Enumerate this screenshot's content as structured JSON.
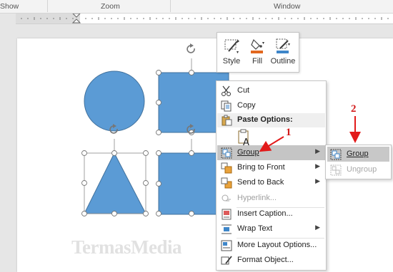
{
  "ribbon": {
    "groups": [
      {
        "label": "Show"
      },
      {
        "label": "Zoom"
      },
      {
        "label": "Window"
      }
    ]
  },
  "mini_toolbar": {
    "buttons": [
      {
        "label": "Style",
        "icon": "shape-style-icon"
      },
      {
        "label": "Fill",
        "icon": "fill-bucket-icon",
        "color": "#e2681f"
      },
      {
        "label": "Outline",
        "icon": "outline-pen-icon",
        "color": "#3e86c9"
      }
    ]
  },
  "context_menu": {
    "cut": "Cut",
    "copy": "Copy",
    "paste_options": "Paste Options:",
    "group": "Group",
    "bring_to_front": "Bring to Front",
    "send_to_back": "Send to Back",
    "hyperlink": "Hyperlink...",
    "insert_caption": "Insert Caption...",
    "wrap_text": "Wrap Text",
    "more_layout": "More Layout Options...",
    "format_object": "Format Object..."
  },
  "submenu": {
    "group": "Group",
    "ungroup": "Ungroup"
  },
  "annotations": {
    "step1": "1",
    "step2": "2",
    "arrow_color": "#e21a1a"
  },
  "colors": {
    "shape_fill": "#5b9bd5",
    "shape_stroke": "#41719c"
  },
  "watermark": "TermasMedia"
}
